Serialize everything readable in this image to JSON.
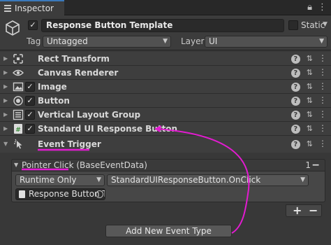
{
  "tab": {
    "title": "Inspector"
  },
  "header": {
    "object_name": "Response Button Template",
    "static_label": "Static",
    "tag_label": "Tag",
    "tag_value": "Untagged",
    "layer_label": "Layer",
    "layer_value": "UI"
  },
  "components": [
    {
      "name": "Rect Transform",
      "has_checkbox": false
    },
    {
      "name": "Canvas Renderer",
      "has_checkbox": false
    },
    {
      "name": "Image",
      "has_checkbox": true
    },
    {
      "name": "Button",
      "has_checkbox": true
    },
    {
      "name": "Vertical Layout Group",
      "has_checkbox": true
    },
    {
      "name": "Standard UI Response Button",
      "has_checkbox": true
    },
    {
      "name": "Event Trigger",
      "has_checkbox": false
    }
  ],
  "event_trigger": {
    "entry_title": "Pointer Click (BaseEventData)",
    "count": "1",
    "runtime_value": "Runtime Only",
    "method_value": "StandardUIResponseButton.OnClick",
    "target_object": "Response Button T",
    "plus": "+",
    "minus": "−"
  },
  "add_event_button": "Add New Event Type",
  "colors": {
    "annotation": "#e31bd1",
    "accent": "#3a79bb"
  },
  "icons": {
    "tab": "hamburger-icon",
    "lock": "lock-icon",
    "object": "cube-icon"
  }
}
